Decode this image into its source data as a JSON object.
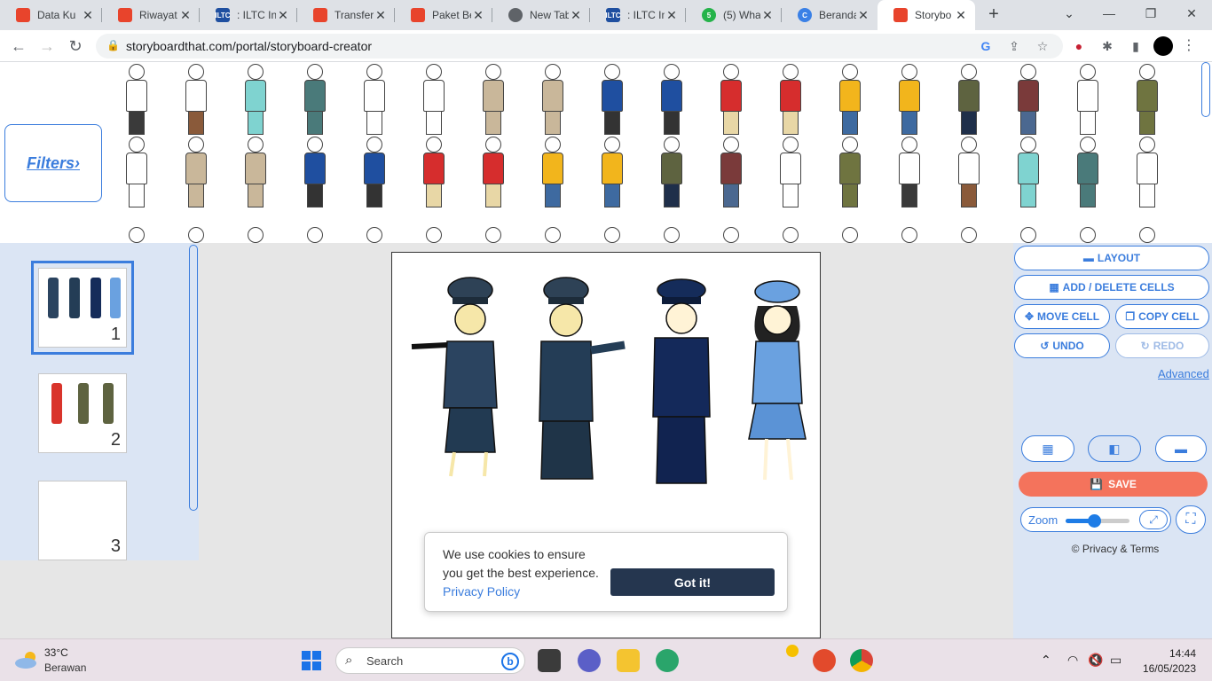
{
  "browser": {
    "tabs": [
      {
        "title": "Data Ku",
        "icon": "red-app-icon",
        "color": "#e8442c"
      },
      {
        "title": "Riwayat",
        "icon": "red-app-icon",
        "color": "#e8442c"
      },
      {
        "title": ": ILTC In",
        "icon": "iltc-icon",
        "color": "#1f4fa0"
      },
      {
        "title": "Transfer",
        "icon": "red-app-icon",
        "color": "#e8442c"
      },
      {
        "title": "Paket Be",
        "icon": "red-app-icon",
        "color": "#e8442c"
      },
      {
        "title": "New Tab",
        "icon": "chrome-icon",
        "color": "#5f6368"
      },
      {
        "title": ": ILTC In",
        "icon": "iltc-icon",
        "color": "#1f4fa0"
      },
      {
        "title": "(5) What",
        "icon": "whatsapp-icon",
        "color": "#25b34a"
      },
      {
        "title": "Beranda",
        "icon": "canva-icon",
        "color": "#3a80e6"
      },
      {
        "title": "Storybo",
        "icon": "storyboard-icon",
        "color": "#e8442c"
      }
    ],
    "url": "storyboardthat.com/portal/storyboard-creator"
  },
  "library": {
    "filters_label": "Filters›"
  },
  "cells": [
    {
      "number": "1"
    },
    {
      "number": "2"
    },
    {
      "number": "3"
    }
  ],
  "cookie": {
    "message": "We use cookies to ensure you get the best experience.",
    "link": "Privacy Policy",
    "button": "Got it!"
  },
  "controls": {
    "layout": "LAYOUT",
    "add_delete": "ADD / DELETE CELLS",
    "move": "MOVE CELL",
    "copy": "COPY CELL",
    "undo": "UNDO",
    "redo": "REDO",
    "advanced": "Advanced",
    "save": "SAVE",
    "zoom_label": "Zoom",
    "zoom_level": 0.45,
    "privacy": "© Privacy & Terms"
  },
  "taskbar": {
    "temperature": "33°C",
    "weather": "Berawan",
    "search": "Search",
    "time": "14:44",
    "date": "16/05/2023"
  },
  "colors": {
    "accent": "#3b7ddd",
    "save": "#f4735c",
    "panel": "#dbe5f4",
    "cookie_button": "#25364f"
  }
}
